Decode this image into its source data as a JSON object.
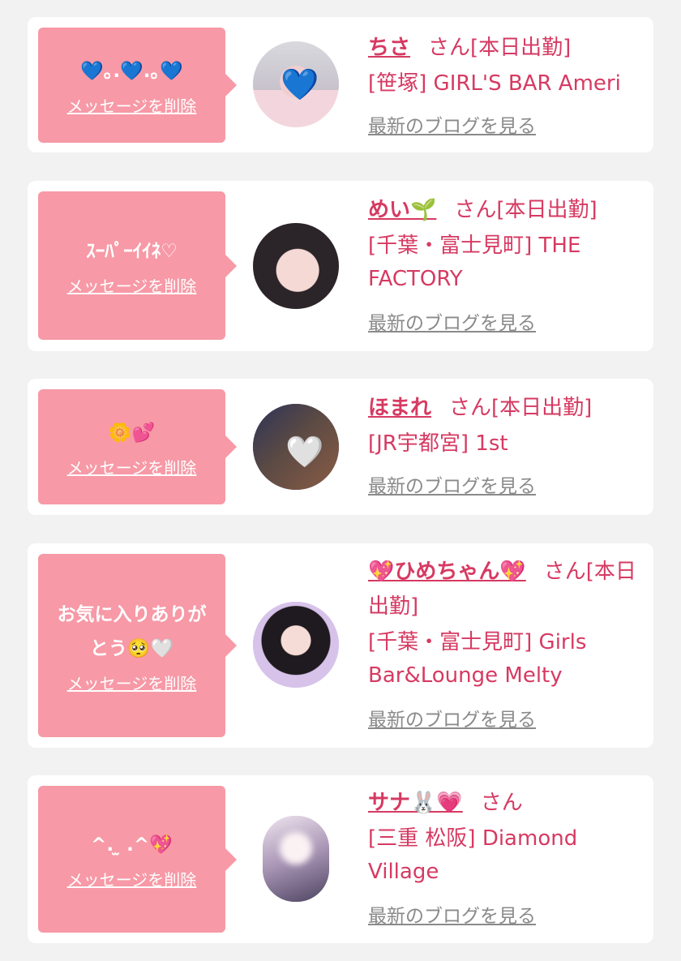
{
  "delete_label": "メッセージを削除",
  "blog_label": "最新のブログを見る",
  "colors": {
    "bubble": "#f799a6",
    "name": "#d63a62",
    "link_gray": "#8a8a8a",
    "background": "#f2f2f2"
  },
  "items": [
    {
      "message": "💙｡.💙.｡💙",
      "name": "ちさ",
      "suffix": "さん[本日出勤]",
      "shop": "[笹塚] GIRL'S BAR Ameri",
      "avatar_icon": "blue-heart-icon"
    },
    {
      "message": "ｽｰﾊﾟｰｲｲﾈ♡",
      "name": "めい🌱",
      "suffix": "さん[本日出勤]",
      "shop": "[千葉・富士見町] THE FACTORY",
      "avatar_icon": "photo"
    },
    {
      "message": "🌼💕",
      "name": "ほまれ",
      "suffix": "さん[本日出勤]",
      "shop": "[JR宇都宮] 1st",
      "avatar_icon": "white-heart-icon"
    },
    {
      "message": "お気に入りありがとう🥺🤍",
      "name": "💖ひめちゃん💖",
      "suffix": "さん[本日出勤]",
      "shop": "[千葉・富士見町] Girls Bar&Lounge Melty",
      "avatar_icon": "photo"
    },
    {
      "message": "^. ̫ .^💖",
      "name": "サナ🐰💗",
      "suffix": "さん",
      "shop": "[三重 松阪] Diamond Village",
      "avatar_icon": "photo"
    }
  ]
}
